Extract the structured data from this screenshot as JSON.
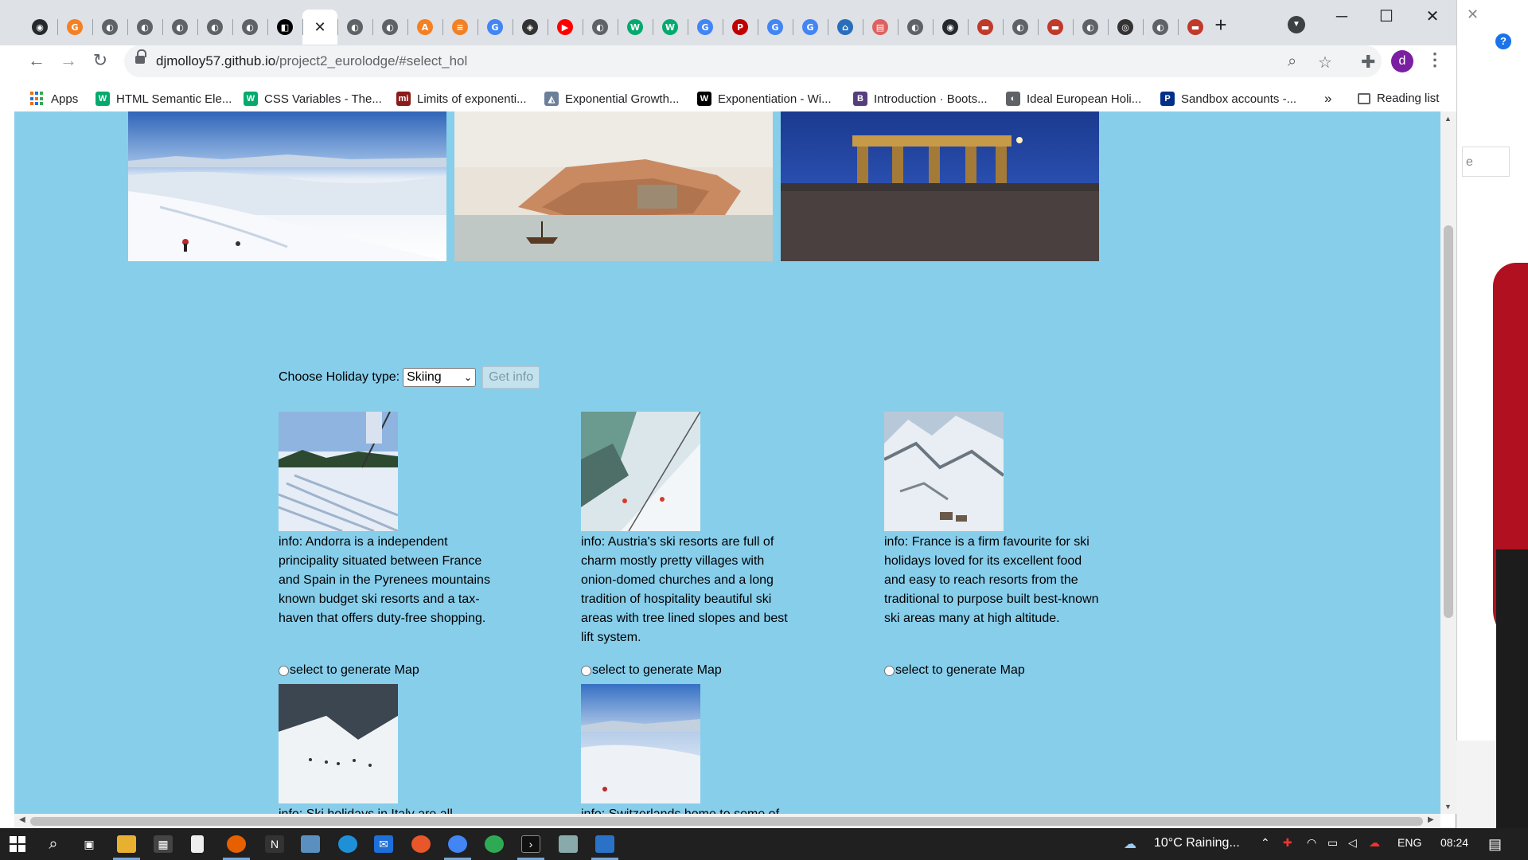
{
  "browser": {
    "address": {
      "domain": "djmolloy57.github.io",
      "path": "/project2_eurolodge/#select_hol"
    },
    "profile_initial": "d",
    "tabs": [
      {
        "icon": "github-icon",
        "glyph": "◉",
        "color": "#24292e"
      },
      {
        "icon": "orange-g-icon",
        "glyph": "G",
        "color": "#f48024"
      },
      {
        "icon": "globe-icon",
        "glyph": "◐",
        "color": "#5f6368"
      },
      {
        "icon": "globe-icon",
        "glyph": "◐",
        "color": "#5f6368"
      },
      {
        "icon": "globe-icon",
        "glyph": "◐",
        "color": "#5f6368"
      },
      {
        "icon": "globe-icon",
        "glyph": "◐",
        "color": "#5f6368"
      },
      {
        "icon": "globe-icon",
        "glyph": "◐",
        "color": "#5f6368"
      },
      {
        "icon": "codepen-icon",
        "glyph": "◧",
        "color": "#000000"
      },
      {
        "icon": "close-icon",
        "glyph": "✕",
        "color": "#202124",
        "active": true
      },
      {
        "icon": "globe-icon",
        "glyph": "◐",
        "color": "#5f6368"
      },
      {
        "icon": "globe-icon",
        "glyph": "◐",
        "color": "#5f6368"
      },
      {
        "icon": "orange-a-icon",
        "glyph": "A",
        "color": "#f48024"
      },
      {
        "icon": "stackoverflow-icon",
        "glyph": "≡",
        "color": "#f48024"
      },
      {
        "icon": "google-icon",
        "glyph": "G",
        "color": "#4285f4"
      },
      {
        "icon": "diamond-icon",
        "glyph": "◈",
        "color": "#333333"
      },
      {
        "icon": "youtube-icon",
        "glyph": "▶",
        "color": "#ff0000"
      },
      {
        "icon": "globe-icon",
        "glyph": "◐",
        "color": "#5f6368"
      },
      {
        "icon": "w3-icon",
        "glyph": "W",
        "color": "#04aa6d"
      },
      {
        "icon": "w3-icon",
        "glyph": "W",
        "color": "#04aa6d"
      },
      {
        "icon": "google-icon",
        "glyph": "G",
        "color": "#4285f4"
      },
      {
        "icon": "pt-icon",
        "glyph": "P",
        "color": "#c00000"
      },
      {
        "icon": "google-icon",
        "glyph": "G",
        "color": "#4285f4"
      },
      {
        "icon": "google-icon",
        "glyph": "G",
        "color": "#4285f4"
      },
      {
        "icon": "bank-icon",
        "glyph": "⌂",
        "color": "#2a6ebb"
      },
      {
        "icon": "doc-icon",
        "glyph": "▤",
        "color": "#e06060"
      },
      {
        "icon": "globe-icon",
        "glyph": "◐",
        "color": "#5f6368"
      },
      {
        "icon": "github-icon",
        "glyph": "◉",
        "color": "#24292e"
      },
      {
        "icon": "red-doc-icon",
        "glyph": "▬",
        "color": "#c0392b"
      },
      {
        "icon": "globe-icon",
        "glyph": "◐",
        "color": "#5f6368"
      },
      {
        "icon": "red-doc-icon",
        "glyph": "▬",
        "color": "#c0392b"
      },
      {
        "icon": "globe-icon",
        "glyph": "◐",
        "color": "#5f6368"
      },
      {
        "icon": "chrome-icon",
        "glyph": "◎",
        "color": "#333333"
      },
      {
        "icon": "globe-icon",
        "glyph": "◐",
        "color": "#5f6368"
      },
      {
        "icon": "red-doc-icon",
        "glyph": "▬",
        "color": "#c0392b"
      }
    ],
    "bookmarks": [
      {
        "label": "Apps",
        "icon": "apps-icon"
      },
      {
        "label": "HTML Semantic Ele...",
        "icon": "w3-icon",
        "glyph": "W",
        "color": "#04aa6d"
      },
      {
        "label": "CSS Variables - The...",
        "icon": "w3-icon",
        "glyph": "W",
        "color": "#04aa6d"
      },
      {
        "label": "Limits of exponenti...",
        "icon": "mi-icon",
        "glyph": "mi",
        "color": "#8b1a1a"
      },
      {
        "label": "Exponential Growth...",
        "icon": "chart-icon",
        "glyph": "◭",
        "color": "#6b7f99"
      },
      {
        "label": "Exponentiation - Wi...",
        "icon": "wikipedia-icon",
        "glyph": "W",
        "color": "#000000"
      },
      {
        "label": "Introduction · Boots...",
        "icon": "bootstrap-icon",
        "glyph": "B",
        "color": "#563d7c"
      },
      {
        "label": "Ideal European Holi...",
        "icon": "globe-icon",
        "glyph": "◐",
        "color": "#5f6368"
      },
      {
        "label": "Sandbox accounts -...",
        "icon": "paypal-icon",
        "glyph": "P",
        "color": "#003087"
      }
    ],
    "bookmarks_more": "»",
    "reading_list": "Reading list"
  },
  "page": {
    "form": {
      "label": "Choose Holiday type:",
      "selected": "Skiing",
      "button": "Get info"
    },
    "cards": [
      {
        "info": "info: Andorra is a independent principality situated between France and Spain in the Pyrenees mountains known budget ski resorts and a tax-haven that offers duty-free shopping.",
        "radio_label": "select to generate Map"
      },
      {
        "info": "info: Austria's ski resorts are full of charm mostly pretty villages with onion-domed churches and a long tradition of hospitality beautiful ski areas with tree lined slopes and best lift system.",
        "radio_label": "select to generate Map"
      },
      {
        "info": "info: France is a firm favourite for ski holidays loved for its excellent food and easy to reach resorts from the traditional to purpose built best-known ski areas many at high altitude.",
        "radio_label": "select to generate Map"
      },
      {
        "info": "info: Ski holidays in Italy are all",
        "radio_label": ""
      },
      {
        "info": "info: Switzerlands home to some of",
        "radio_label": ""
      }
    ],
    "colors": {
      "page_bg": "#87ceeb"
    }
  },
  "taskbar": {
    "weather": "10°C  Raining...",
    "language": "ENG",
    "time": "08:24"
  }
}
